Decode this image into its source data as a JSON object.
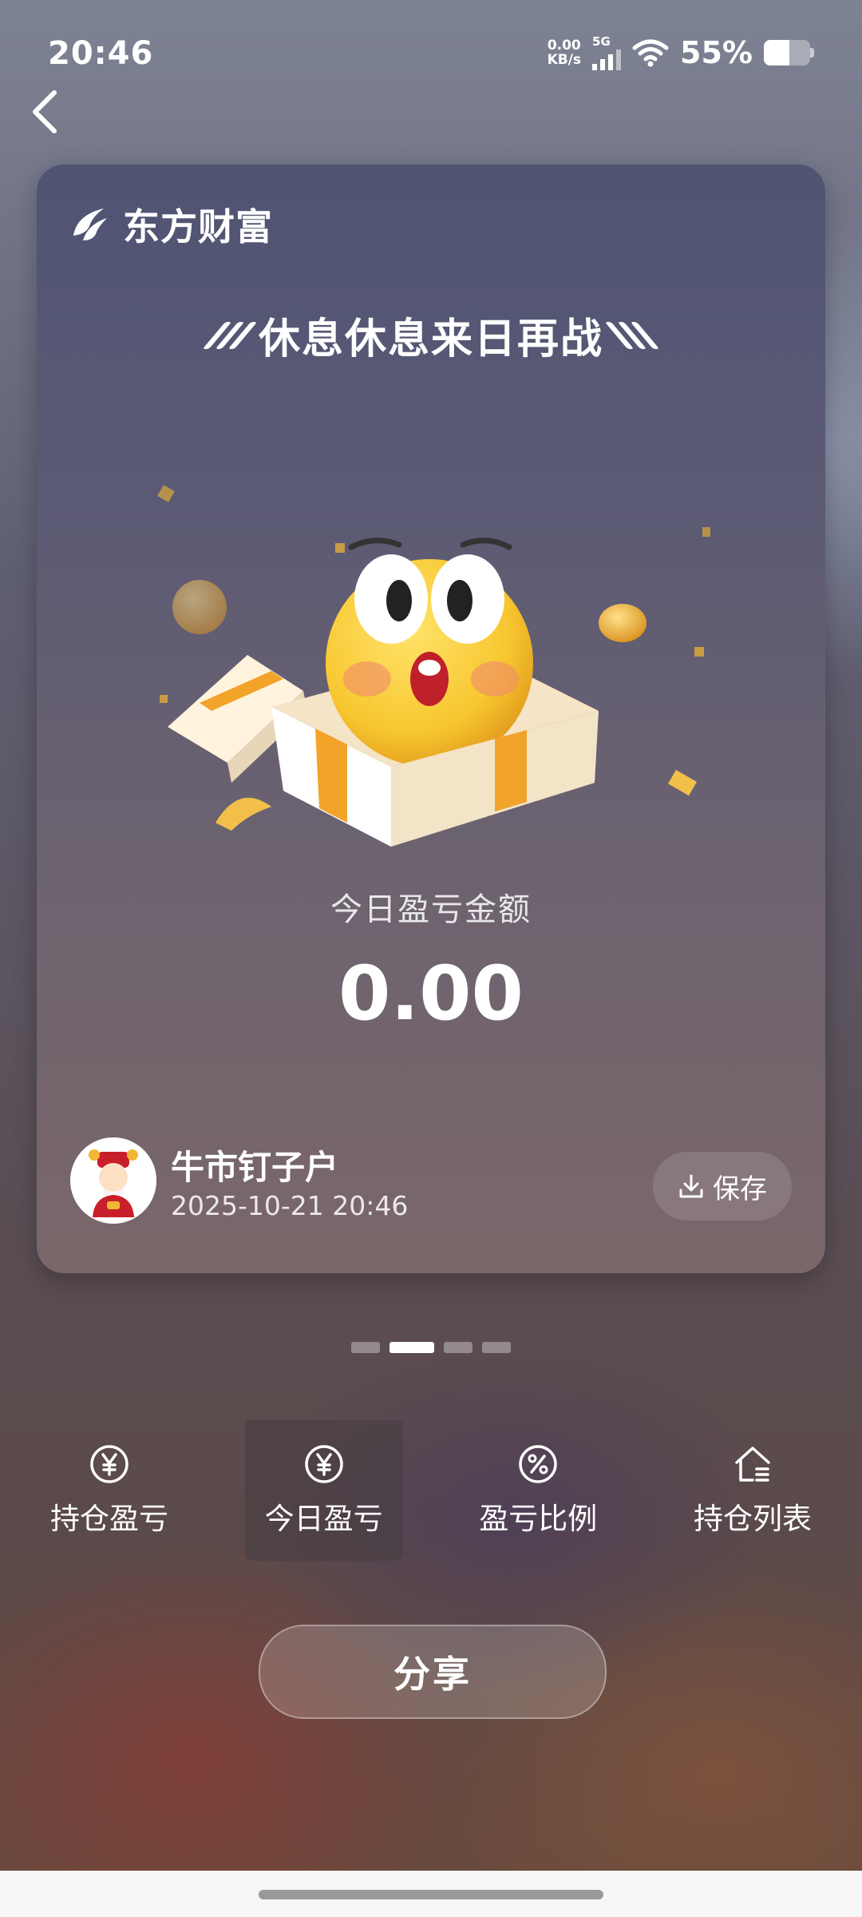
{
  "status_bar": {
    "time": "20:46",
    "net_speed_value": "0.00",
    "net_speed_unit": "KB/s",
    "network_type": "5G",
    "battery_percent": "55%",
    "battery_level": 0.55
  },
  "card": {
    "brand_name": "东方财富",
    "slogan": "休息休息来日再战",
    "pnl_label": "今日盈亏金额",
    "pnl_value": "0.00",
    "user": {
      "name": "牛市钉子户",
      "timestamp": "2025-10-21 20:46"
    },
    "save_label": "保存"
  },
  "pager": {
    "count": 4,
    "active_index": 1
  },
  "tabs": [
    {
      "label": "持仓盈亏",
      "icon": "yen-circle-icon",
      "active": false
    },
    {
      "label": "今日盈亏",
      "icon": "yen-circle-icon",
      "active": true
    },
    {
      "label": "盈亏比例",
      "icon": "percent-circle-icon",
      "active": false
    },
    {
      "label": "持仓列表",
      "icon": "house-list-icon",
      "active": false
    }
  ],
  "share_label": "分享",
  "colors": {
    "card_top": "#4f5473",
    "card_bottom": "#7a6769",
    "coin_gold": "#f2b632",
    "face_yellow": "#f7c62f"
  }
}
